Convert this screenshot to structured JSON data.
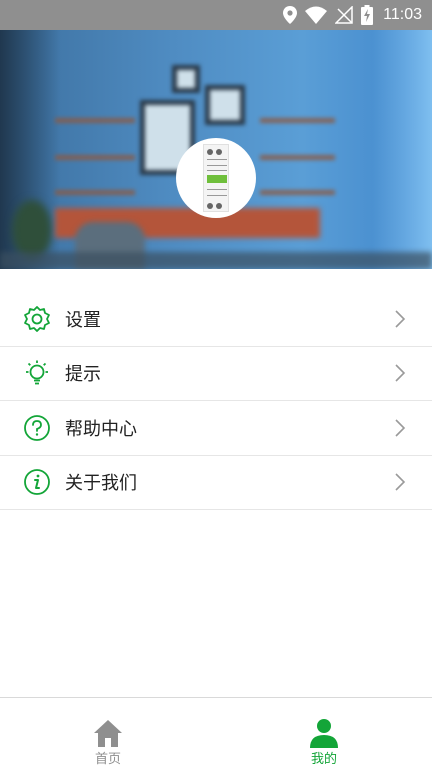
{
  "status_bar": {
    "time": "11:03"
  },
  "colors": {
    "accent": "#13a538",
    "inactive": "#8f8f8f",
    "status_bar": "#8f8f8f"
  },
  "menu": {
    "items": [
      {
        "label": "设置",
        "icon": "gear-icon"
      },
      {
        "label": "提示",
        "icon": "lightbulb-icon"
      },
      {
        "label": "帮助中心",
        "icon": "question-circle-icon"
      },
      {
        "label": "关于我们",
        "icon": "info-circle-icon"
      }
    ]
  },
  "bottom_nav": {
    "tabs": [
      {
        "label": "首页",
        "icon": "home-icon",
        "active": false
      },
      {
        "label": "我的",
        "icon": "person-icon",
        "active": true
      }
    ]
  }
}
